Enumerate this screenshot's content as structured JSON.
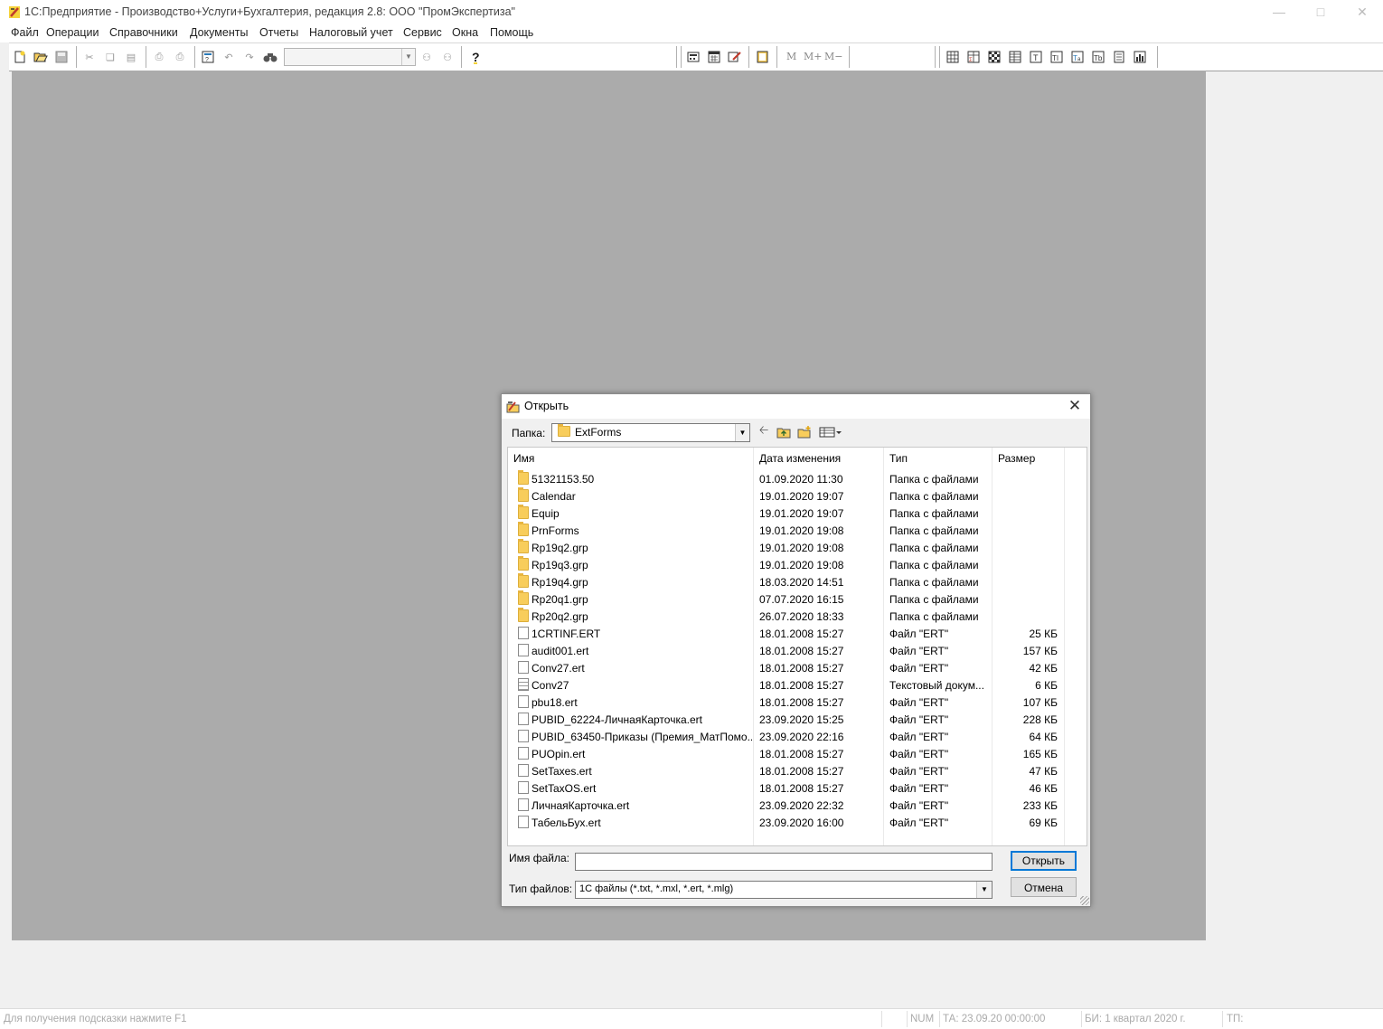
{
  "window": {
    "title": "1С:Предприятие - Производство+Услуги+Бухгалтерия, редакция 2.8: ООО \"ПромЭкспертиза\""
  },
  "menu": [
    "Файл",
    "Операции",
    "Справочники",
    "Документы",
    "Отчеты",
    "Налоговый учет",
    "Сервис",
    "Окна",
    "Помощь"
  ],
  "toolbar": {
    "icons": [
      "new-icon",
      "open-icon",
      "save-icon",
      "cut-icon",
      "copy-icon",
      "paste-icon",
      "print-icon",
      "print-preview-icon",
      "find-icon",
      "undo-icon",
      "redo-icon",
      "binoculars-icon",
      "search-next-icon",
      "search-prev-icon",
      "help-icon",
      "calculator-icon",
      "calendar-icon",
      "journal-icon",
      "book-icon",
      "table-icons"
    ],
    "memory_buttons": [
      "M",
      "M+",
      "M−"
    ]
  },
  "dialog": {
    "title": "Открыть",
    "folder_label": "Папка:",
    "folder_value": "ExtForms",
    "columns": [
      "Имя",
      "Дата изменения",
      "Тип",
      "Размер"
    ],
    "files": [
      {
        "name": "51321153.50",
        "date": "01.09.2020 11:30",
        "type": "Папка с файлами",
        "size": "",
        "kind": "folder"
      },
      {
        "name": "Calendar",
        "date": "19.01.2020 19:07",
        "type": "Папка с файлами",
        "size": "",
        "kind": "folder"
      },
      {
        "name": "Equip",
        "date": "19.01.2020 19:07",
        "type": "Папка с файлами",
        "size": "",
        "kind": "folder"
      },
      {
        "name": "PrnForms",
        "date": "19.01.2020 19:08",
        "type": "Папка с файлами",
        "size": "",
        "kind": "folder"
      },
      {
        "name": "Rp19q2.grp",
        "date": "19.01.2020 19:08",
        "type": "Папка с файлами",
        "size": "",
        "kind": "folder"
      },
      {
        "name": "Rp19q3.grp",
        "date": "19.01.2020 19:08",
        "type": "Папка с файлами",
        "size": "",
        "kind": "folder"
      },
      {
        "name": "Rp19q4.grp",
        "date": "18.03.2020 14:51",
        "type": "Папка с файлами",
        "size": "",
        "kind": "folder"
      },
      {
        "name": "Rp20q1.grp",
        "date": "07.07.2020 16:15",
        "type": "Папка с файлами",
        "size": "",
        "kind": "folder"
      },
      {
        "name": "Rp20q2.grp",
        "date": "26.07.2020 18:33",
        "type": "Папка с файлами",
        "size": "",
        "kind": "folder"
      },
      {
        "name": "1CRTINF.ERT",
        "date": "18.01.2008 15:27",
        "type": "Файл \"ERT\"",
        "size": "25 КБ",
        "kind": "file"
      },
      {
        "name": "audit001.ert",
        "date": "18.01.2008 15:27",
        "type": "Файл \"ERT\"",
        "size": "157 КБ",
        "kind": "file"
      },
      {
        "name": "Conv27.ert",
        "date": "18.01.2008 15:27",
        "type": "Файл \"ERT\"",
        "size": "42 КБ",
        "kind": "file"
      },
      {
        "name": "Conv27",
        "date": "18.01.2008 15:27",
        "type": "Текстовый докум...",
        "size": "6 КБ",
        "kind": "text"
      },
      {
        "name": "pbu18.ert",
        "date": "18.01.2008 15:27",
        "type": "Файл \"ERT\"",
        "size": "107 КБ",
        "kind": "file"
      },
      {
        "name": "PUBID_62224-ЛичнаяКарточка.ert",
        "date": "23.09.2020 15:25",
        "type": "Файл \"ERT\"",
        "size": "228 КБ",
        "kind": "file"
      },
      {
        "name": "PUBID_63450-Приказы (Премия_МатПомо...",
        "date": "23.09.2020 22:16",
        "type": "Файл \"ERT\"",
        "size": "64 КБ",
        "kind": "file"
      },
      {
        "name": "PUOpin.ert",
        "date": "18.01.2008 15:27",
        "type": "Файл \"ERT\"",
        "size": "165 КБ",
        "kind": "file"
      },
      {
        "name": "SetTaxes.ert",
        "date": "18.01.2008 15:27",
        "type": "Файл \"ERT\"",
        "size": "47 КБ",
        "kind": "file"
      },
      {
        "name": "SetTaxOS.ert",
        "date": "18.01.2008 15:27",
        "type": "Файл \"ERT\"",
        "size": "46 КБ",
        "kind": "file"
      },
      {
        "name": "ЛичнаяКарточка.ert",
        "date": "23.09.2020 22:32",
        "type": "Файл \"ERT\"",
        "size": "233 КБ",
        "kind": "file"
      },
      {
        "name": "ТабельБух.ert",
        "date": "23.09.2020 16:00",
        "type": "Файл \"ERT\"",
        "size": "69 КБ",
        "kind": "file"
      }
    ],
    "filename_label": "Имя файла:",
    "filename_value": "",
    "filetype_label": "Тип файлов:",
    "filetype_value": "1С файлы (*.txt, *.mxl, *.ert, *.mlg)",
    "open_button": "Открыть",
    "cancel_button": "Отмена"
  },
  "statusbar": {
    "hint": "Для получения подсказки нажмите F1",
    "num": "NUM",
    "ta": "ТА: 23.09.20  00:00:00",
    "bi": "БИ: 1 квартал 2020 г.",
    "tp": "ТП:"
  }
}
